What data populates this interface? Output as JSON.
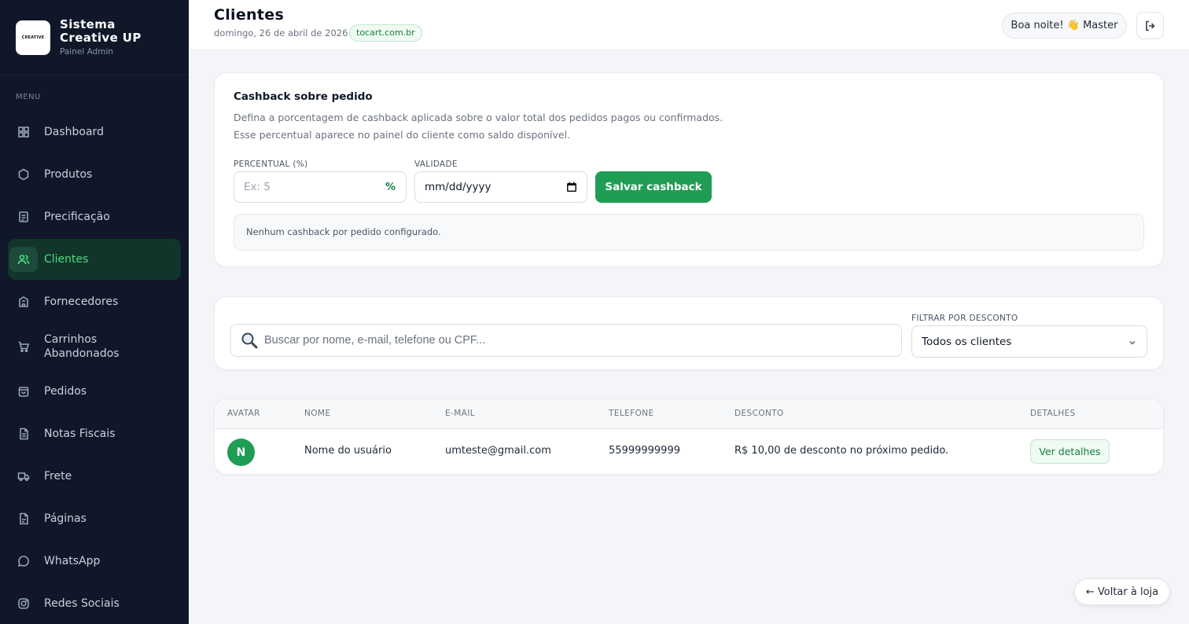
{
  "brand": {
    "logo_text": "CREATIVE",
    "title_line1": "Sistema",
    "title_line2": "Creative UP",
    "subtitle": "Painel Admin"
  },
  "sidebar": {
    "menu_label": "MENU",
    "items": [
      {
        "label": "Dashboard",
        "icon": "grid-icon"
      },
      {
        "label": "Produtos",
        "icon": "hexagon-icon"
      },
      {
        "label": "Precificação",
        "icon": "document-icon"
      },
      {
        "label": "Clientes",
        "icon": "users-icon",
        "active": true
      },
      {
        "label": "Fornecedores",
        "icon": "building-icon"
      },
      {
        "label": "Carrinhos Abandonados",
        "icon": "cart-icon"
      },
      {
        "label": "Pedidos",
        "icon": "bag-icon"
      },
      {
        "label": "Notas Fiscais",
        "icon": "receipt-icon"
      },
      {
        "label": "Frete",
        "icon": "truck-icon"
      },
      {
        "label": "Páginas",
        "icon": "page-icon"
      },
      {
        "label": "WhatsApp",
        "icon": "chat-icon"
      },
      {
        "label": "Redes Sociais",
        "icon": "instagram-icon"
      }
    ]
  },
  "header": {
    "title": "Clientes",
    "date": "domingo, 26 de abril de 2026",
    "domain": "tocart.com.br",
    "greeting": "Boa noite! 👋 Master"
  },
  "cashback": {
    "title": "Cashback sobre pedido",
    "desc_line1": "Defina a porcentagem de cashback aplicada sobre o valor total dos pedidos pagos ou confirmados.",
    "desc_line2": "Esse percentual aparece no painel do cliente como saldo disponível.",
    "percent_label": "PERCENTUAL (%)",
    "percent_placeholder": "Ex: 5",
    "percent_suffix": "%",
    "validity_label": "VALIDADE",
    "validity_value": "mm/dd/yyyy",
    "save_label": "Salvar cashback",
    "empty_notice": "Nenhum cashback por pedido configurado."
  },
  "filters": {
    "search_placeholder": "Buscar por nome, e-mail, telefone ou CPF...",
    "filter_label": "FILTRAR POR DESCONTO",
    "filter_value": "Todos os clientes"
  },
  "table": {
    "headers": [
      "AVATAR",
      "NOME",
      "E-MAIL",
      "TELEFONE",
      "DESCONTO",
      "DETALHES"
    ],
    "rows": [
      {
        "initial": "N",
        "name": "Nome do usuário",
        "email": "umteste@gmail.com",
        "phone": "55999999999",
        "discount": "R$ 10,00 de desconto no próximo pedido.",
        "details": "Ver detalhes"
      }
    ]
  },
  "footer": {
    "back_label": "← Voltar à loja"
  },
  "colors": {
    "sidebar_bg": "#0f1729",
    "accent": "#1f9d55",
    "active_text": "#4ade80"
  }
}
